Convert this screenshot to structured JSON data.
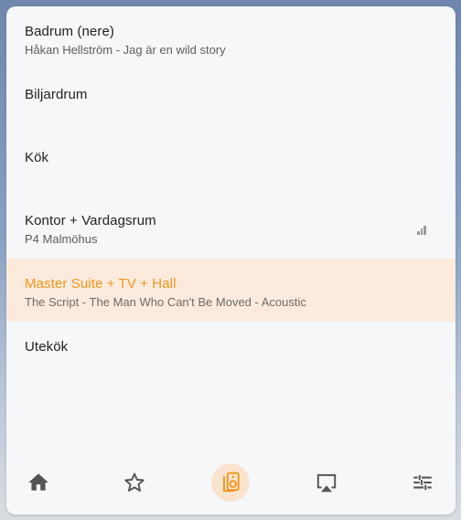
{
  "rooms": [
    {
      "name": "Badrum (nere)",
      "subtitle": "Håkan Hellström - Jag är en wild story",
      "active": false
    },
    {
      "name": "Biljardrum",
      "subtitle": "",
      "active": false
    },
    {
      "name": "Kök",
      "subtitle": "",
      "active": false
    },
    {
      "name": "Kontor + Vardagsrum",
      "subtitle": "P4 Malmöhus",
      "active": false
    },
    {
      "name": "Master Suite + TV + Hall",
      "subtitle": "The Script - The Man Who Can't Be Moved - Acoustic",
      "active": true
    },
    {
      "name": "Utekök",
      "subtitle": "",
      "active": false
    }
  ],
  "tabs": [
    {
      "icon": "home-icon"
    },
    {
      "icon": "star-icon"
    },
    {
      "icon": "speaker-icon",
      "active": true
    },
    {
      "icon": "airplay-icon"
    },
    {
      "icon": "sliders-icon"
    }
  ],
  "colors": {
    "accent": "#f0961e",
    "active_row_bg": "#fcebdc",
    "icon": "#555555"
  }
}
